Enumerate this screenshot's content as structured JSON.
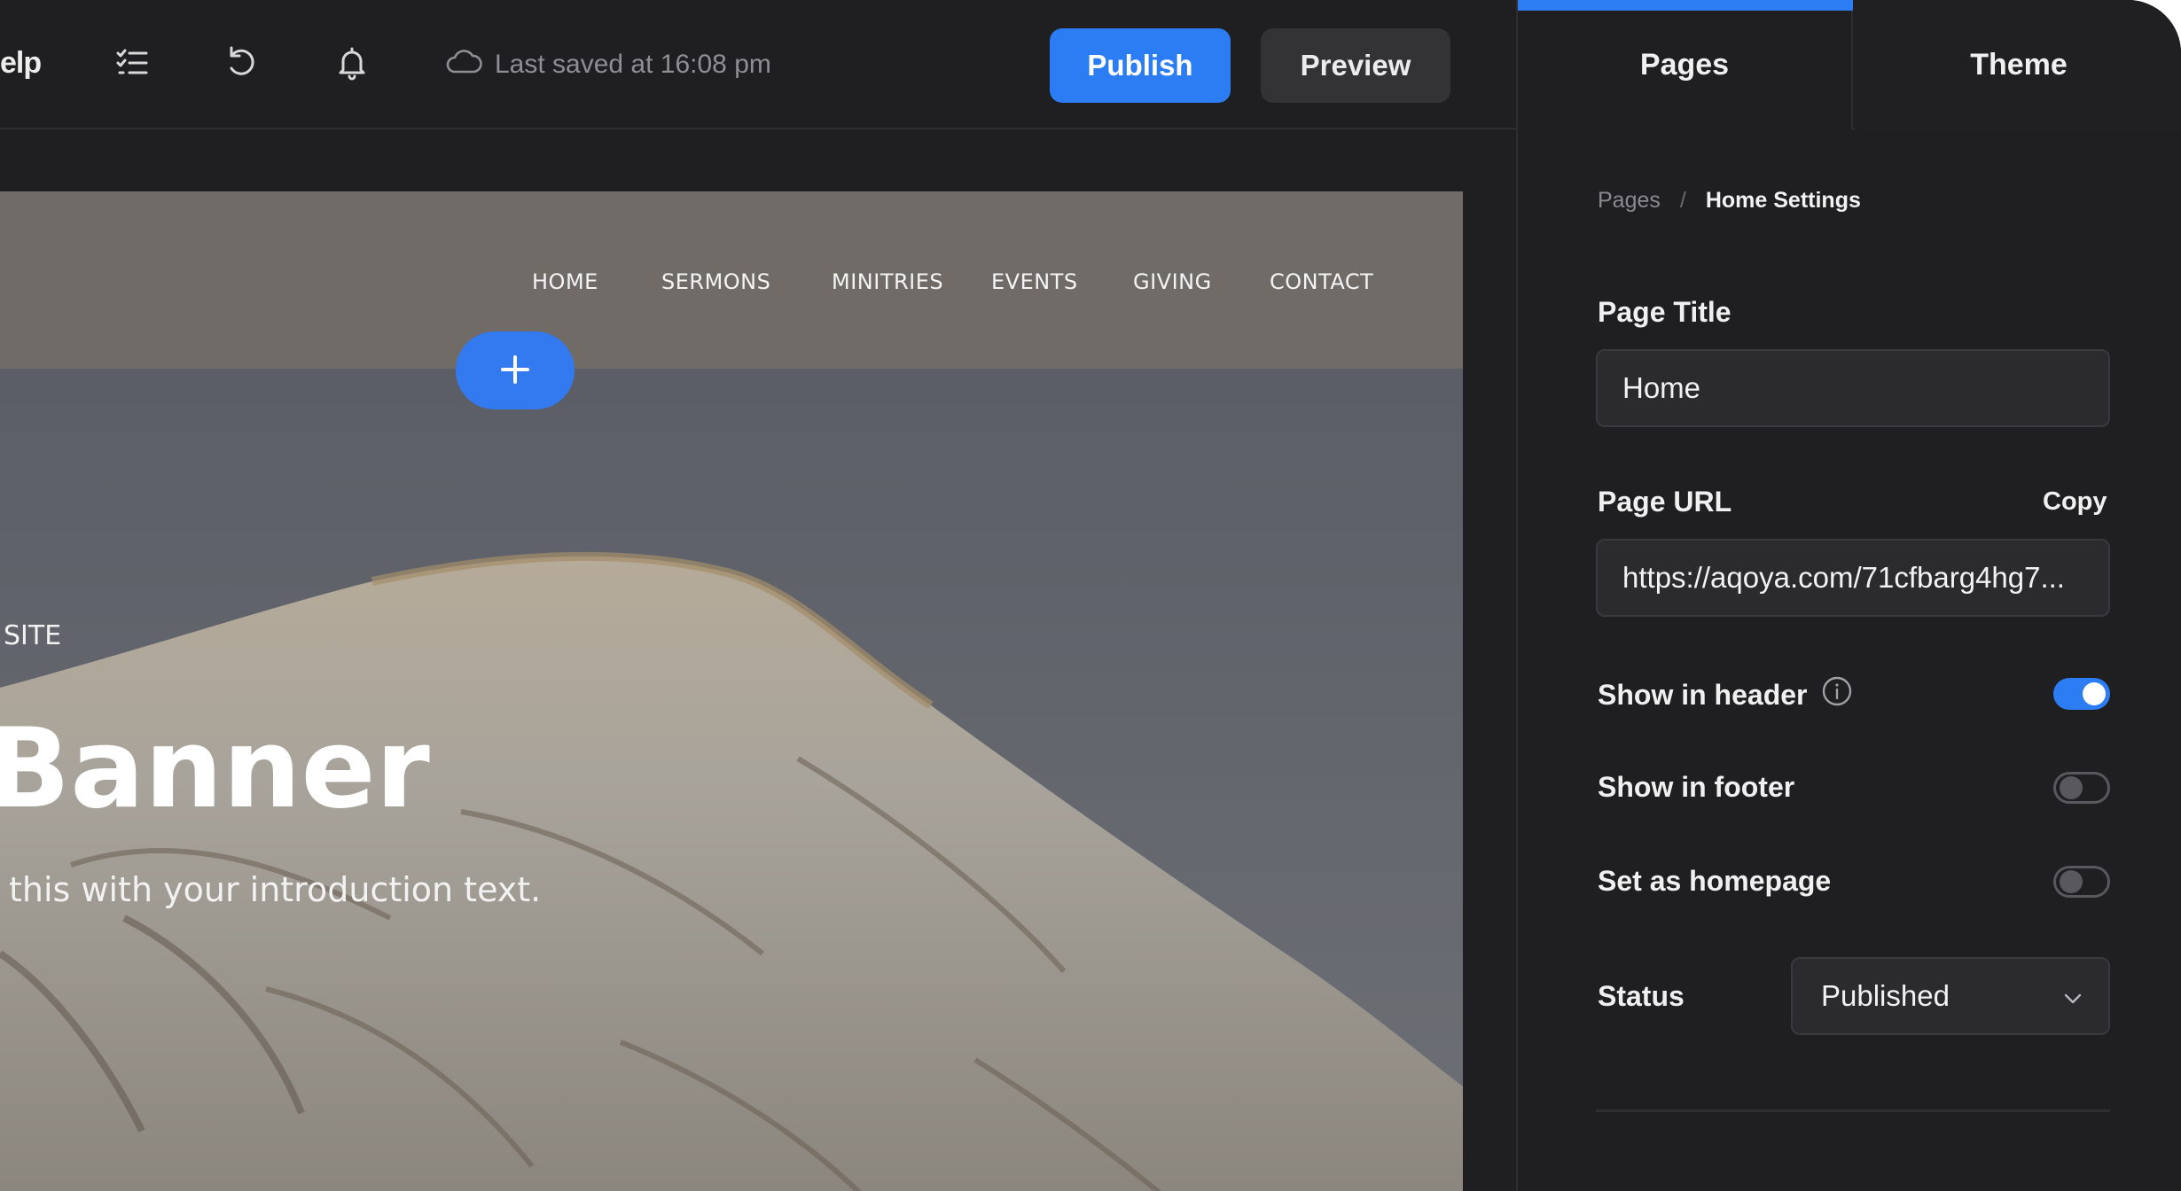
{
  "toolbar": {
    "help_label": "elp",
    "icons": [
      "checklist-icon",
      "undo-icon",
      "bell-icon",
      "cloud-icon"
    ],
    "saved_status": "Last saved at 16:08 pm",
    "publish_label": "Publish",
    "preview_label": "Preview"
  },
  "site": {
    "nav": [
      "HOME",
      "SERMONS",
      "MINITRIES",
      "EVENTS",
      "GIVING",
      "CONTACT"
    ],
    "add_label": "+",
    "hero": {
      "kicker": "SITE",
      "title": "Banner",
      "subtitle": "this with your introduction text."
    }
  },
  "panel": {
    "tabs": [
      "Pages",
      "Theme"
    ],
    "breadcrumb": {
      "root": "Pages",
      "separator": "/",
      "current": "Home Settings"
    },
    "page_title": {
      "label": "Page Title",
      "value": "Home"
    },
    "page_url": {
      "label": "Page URL",
      "copy_label": "Copy",
      "value": "https://aqoya.com/71cfbarg4hg7..."
    },
    "toggles": [
      {
        "label": "Show in header",
        "on": true
      },
      {
        "label": "Show in footer",
        "on": false
      },
      {
        "label": "Set as homepage",
        "on": false
      }
    ],
    "status": {
      "label": "Status",
      "value": "Published"
    }
  },
  "colors": {
    "accent": "#2c7df3",
    "background": "#1f1f21",
    "input_background": "#2b2b2e"
  }
}
